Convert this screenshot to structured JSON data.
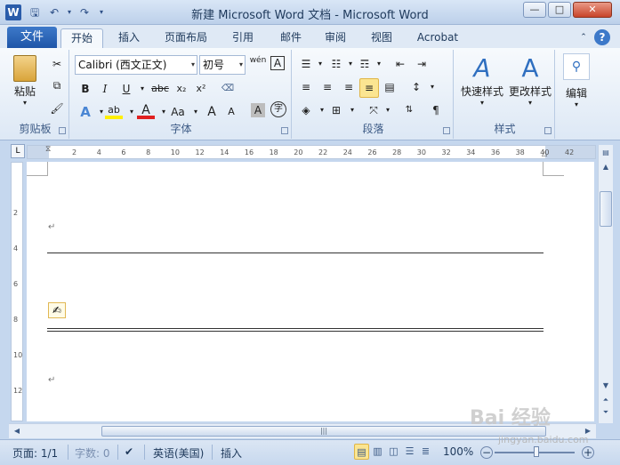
{
  "window": {
    "app_icon": "W",
    "title": "新建 Microsoft Word 文档 - Microsoft Word",
    "minimize": "—",
    "maximize": "□",
    "close": "✕",
    "qa_save": "🖫",
    "qa_undo": "↶",
    "qa_redo": "↷",
    "qa_more": "▾"
  },
  "tabs": {
    "file": "文件",
    "items": [
      "开始",
      "插入",
      "页面布局",
      "引用",
      "邮件",
      "审阅",
      "视图",
      "Acrobat"
    ],
    "active": "开始",
    "help": "?"
  },
  "clipboard": {
    "paste": "粘贴",
    "label": "剪贴板"
  },
  "font": {
    "family": "Calibri (西文正文)",
    "size": "初号",
    "wen": "wén",
    "bold": "B",
    "italic": "I",
    "underline": "U",
    "strike": "abc",
    "sub": "x₂",
    "sup": "x²",
    "effects": "A",
    "highlight": "ab",
    "color": "A",
    "change_case": "Aa",
    "grow": "A",
    "shrink": "A",
    "shade": "A",
    "circle": "字",
    "label": "字体"
  },
  "paragraph": {
    "label": "段落"
  },
  "styles": {
    "quick": "快速样式",
    "change": "更改样式",
    "label": "样式"
  },
  "editing": {
    "label": "编辑"
  },
  "ruler": {
    "ticks": [
      "2",
      "4",
      "6",
      "8",
      "10",
      "12",
      "14",
      "16",
      "18",
      "20",
      "22",
      "24",
      "26",
      "28",
      "30",
      "32",
      "34",
      "36",
      "38",
      "40",
      "42"
    ],
    "vticks": [
      "2",
      "4",
      "6",
      "8",
      "10",
      "12"
    ],
    "corner": "L"
  },
  "document": {
    "para_mark_1": "↵",
    "para_mark_2": "↵",
    "anchor_icon": "✍"
  },
  "statusbar": {
    "page": "页面: 1/1",
    "words": "字数: 0",
    "language": "英语(美国)",
    "insert": "插入",
    "zoom": "100%",
    "zoom_minus": "−",
    "zoom_plus": "+"
  },
  "watermark": {
    "text": "Bai 经验",
    "sub": "jingyan.baidu.com"
  }
}
